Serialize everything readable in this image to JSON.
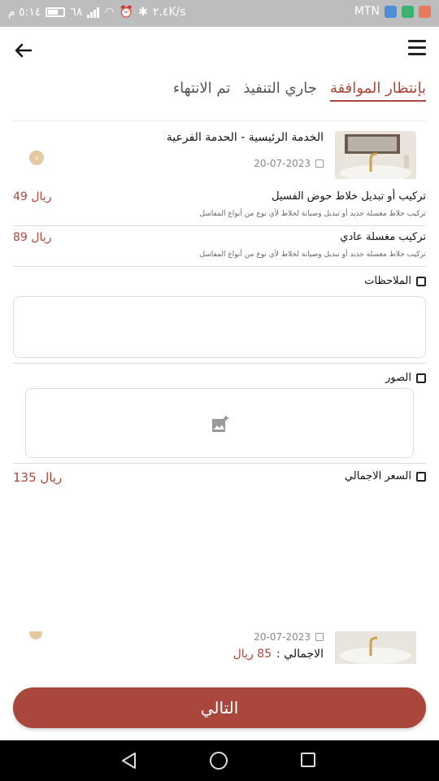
{
  "status_bar": {
    "time": "٥:١٤ م",
    "battery": "٦٨",
    "speed": "٢.٤K/s",
    "carrier": "MTN"
  },
  "tabs": [
    {
      "label": "بإنتظار الموافقة",
      "active": true
    },
    {
      "label": "جاري التنفيذ",
      "active": false
    },
    {
      "label": "تم الانتهاء",
      "active": false
    }
  ],
  "order_card": {
    "title": "الخدمة الرئيسية - الحدمة الفرعية",
    "date": "20-07-2023"
  },
  "services": [
    {
      "name": "تركيب أو تبديل خلاط حوض الفسيل",
      "description": "تركيب خلاط مغسلة جديد أو تبديل وصيانة لخلاط لأي نوع من أنواع المفاسل",
      "price": "49 ريال"
    },
    {
      "name": "تركيب مغسلة عادي",
      "description": "تركيب خلاط مغسلة جديد أو تبديل وصيانة لخلاط لأي نوع من أنواع المفاسل",
      "price": "89 ريال"
    }
  ],
  "notes_label": "الملاحظات",
  "photos_label": "الصور",
  "total": {
    "label": "السعر الاجمالي",
    "value": "135 ريال"
  },
  "second_card": {
    "date": "20-07-2023",
    "total_label": "الاجمالي :",
    "total_value": "85 ريال"
  },
  "next_button": "التالي",
  "colors": {
    "accent": "#a9473c",
    "status_bar": "#bdbdbd"
  }
}
